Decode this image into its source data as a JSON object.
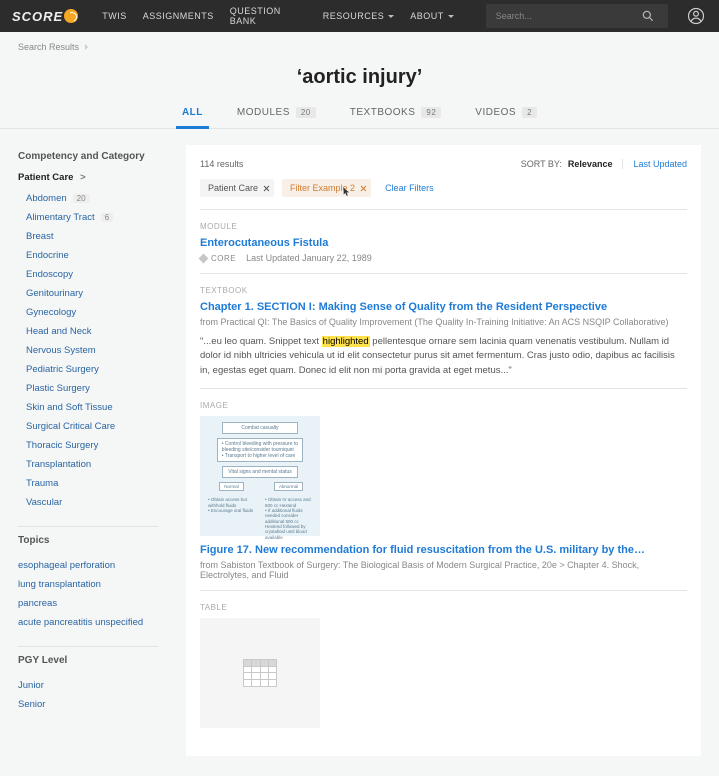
{
  "nav": {
    "logo": "SCORE",
    "items": [
      "TWIS",
      "ASSIGNMENTS",
      "QUESTION BANK",
      "RESOURCES",
      "ABOUT"
    ],
    "dropdown_flags": [
      false,
      false,
      false,
      true,
      true
    ],
    "search_placeholder": "Search..."
  },
  "crumb": {
    "item": "Search Results"
  },
  "query": "‘aortic injury’",
  "tabs": [
    {
      "label": "ALL",
      "count": null,
      "active": true
    },
    {
      "label": "MODULES",
      "count": "20",
      "active": false
    },
    {
      "label": "TEXTBOOKS",
      "count": "92",
      "active": false
    },
    {
      "label": "VIDEOS",
      "count": "2",
      "active": false
    }
  ],
  "sidebar": {
    "heading": "Competency and Category",
    "group_title": "Patient Care",
    "items": [
      {
        "label": "Abdomen",
        "count": "20"
      },
      {
        "label": "Alimentary Tract",
        "count": "6"
      },
      {
        "label": "Breast",
        "count": null
      },
      {
        "label": "Endocrine",
        "count": null
      },
      {
        "label": "Endoscopy",
        "count": null
      },
      {
        "label": "Genitourinary",
        "count": null
      },
      {
        "label": "Gynecology",
        "count": null
      },
      {
        "label": "Head and Neck",
        "count": null
      },
      {
        "label": "Nervous System",
        "count": null
      },
      {
        "label": "Pediatric Surgery",
        "count": null
      },
      {
        "label": "Plastic Surgery",
        "count": null
      },
      {
        "label": "Skin and Soft Tissue",
        "count": null
      },
      {
        "label": "Surgical Critical Care",
        "count": null
      },
      {
        "label": "Thoracic Surgery",
        "count": null
      },
      {
        "label": "Transplantation",
        "count": null
      },
      {
        "label": "Trauma",
        "count": null
      },
      {
        "label": "Vascular",
        "count": null
      }
    ],
    "topics_heading": "Topics",
    "topics": [
      "esophageal perforation",
      "lung transplantation",
      "pancreas",
      "acute pancreatitis unspecified"
    ],
    "pgy_heading": "PGY Level",
    "pgy": [
      "Junior",
      "Senior"
    ]
  },
  "results": {
    "count_text": "114 results",
    "sort_label": "SORT BY:",
    "sort_a": "Relevance",
    "sort_b": "Last Updated",
    "chips": [
      {
        "label": "Patient Care",
        "tan": false
      },
      {
        "label": "Filter Example 2",
        "tan": true,
        "cursor": true
      }
    ],
    "clear": "Clear Filters",
    "sections": {
      "module": {
        "label": "MODULE",
        "title": "Enterocutaneous Fistula",
        "core": "CORE",
        "updated": "Last Updated January 22, 1989"
      },
      "textbook": {
        "label": "TEXTBOOK",
        "title": "Chapter 1. SECTION I: Making Sense of Quality from the Resident Perspective",
        "source": "from Practical QI: The Basics of Quality Improvement (The Quality In-Training Initiative: An ACS NSQIP Collaborative)",
        "snippet_pre": "\"...eu leo quam. Snippet text ",
        "snippet_hi": "highlighted",
        "snippet_post": " pellentesque ornare sem lacinia quam venenatis vestibulum. Nullam id dolor id nibh ultricies vehicula ut id elit consectetur purus sit amet fermentum. Cras justo odio, dapibus ac facilisis in, egestas eget quam. Donec id elit non mi porta gravida at eget metus...\""
      },
      "image": {
        "label": "IMAGE",
        "flow": {
          "a": "Combat casualty",
          "b": "• Control bleeding with pressure to bleeding site/consider tourniquet\n• Transport to higher level of care",
          "c": "Vital signs and mental status",
          "d_left": "Normal",
          "d_right": "Abnormal",
          "e_left": "• Obtain access but withhold fluids\n• Encourage oral fluids",
          "e_right": "• Obtain IV access and 500 cc Hextend\n• If additional fluids needed consider additional 500 cc Hextend followed by crystalloid until blood available"
        },
        "title": "Figure 17. New recommendation for fluid resuscitation from the U.S. military by the…",
        "source": "from Sabiston Textbook of Surgery: The Biological Basis of Modern Surgical Practice, 20e   >   Chapter 4. Shock, Electrolytes, and Fluid"
      },
      "table": {
        "label": "TABLE"
      }
    }
  }
}
